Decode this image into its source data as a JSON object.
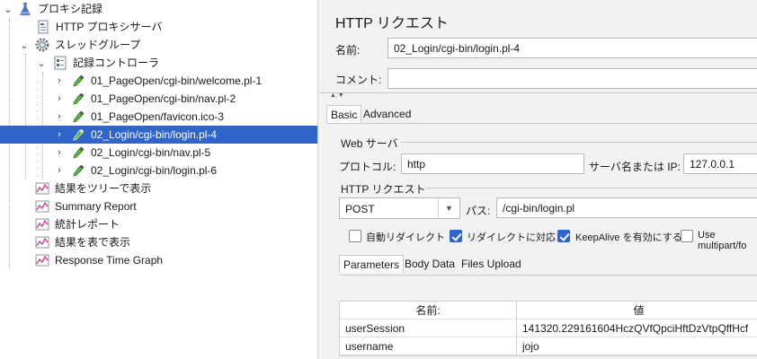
{
  "tree": {
    "items": [
      {
        "id": "proxy-root",
        "label": "プロキシ記録",
        "icon": "flask-icon",
        "toggle": "v",
        "selected": false
      },
      {
        "id": "http-proxy-server",
        "label": "HTTP プロキシサーバ",
        "icon": "config-element-icon",
        "toggle": "",
        "selected": false
      },
      {
        "id": "thread-group",
        "label": "スレッドグループ",
        "icon": "gear-icon",
        "toggle": "v",
        "selected": false
      },
      {
        "id": "recording-controller",
        "label": "記録コントローラ",
        "icon": "controller-icon",
        "toggle": "v",
        "selected": false
      },
      {
        "id": "sampler-1",
        "label": "01_PageOpen/cgi-bin/welcome.pl-1",
        "icon": "pipette-icon",
        "toggle": ">",
        "selected": false
      },
      {
        "id": "sampler-2",
        "label": "01_PageOpen/cgi-bin/nav.pl-2",
        "icon": "pipette-icon",
        "toggle": ">",
        "selected": false
      },
      {
        "id": "sampler-3",
        "label": "01_PageOpen/favicon.ico-3",
        "icon": "pipette-icon",
        "toggle": ">",
        "selected": false
      },
      {
        "id": "sampler-4",
        "label": "02_Login/cgi-bin/login.pl-4",
        "icon": "pipette-icon",
        "toggle": ">",
        "selected": true
      },
      {
        "id": "sampler-5",
        "label": "02_Login/cgi-bin/nav.pl-5",
        "icon": "pipette-icon",
        "toggle": ">",
        "selected": false
      },
      {
        "id": "sampler-6",
        "label": "02_Login/cgi-bin/login.pl-6",
        "icon": "pipette-icon",
        "toggle": ">",
        "selected": false
      },
      {
        "id": "listener-tree",
        "label": "結果をツリーで表示",
        "icon": "graph-icon",
        "toggle": "",
        "selected": false
      },
      {
        "id": "listener-summary",
        "label": "Summary Report",
        "icon": "graph-icon",
        "toggle": "",
        "selected": false
      },
      {
        "id": "listener-stats",
        "label": "統計レポート",
        "icon": "graph-icon",
        "toggle": "",
        "selected": false
      },
      {
        "id": "listener-table",
        "label": "結果を表で表示",
        "icon": "graph-icon",
        "toggle": "",
        "selected": false
      },
      {
        "id": "listener-response-time",
        "label": "Response Time Graph",
        "icon": "graph-icon",
        "toggle": "",
        "selected": false
      }
    ]
  },
  "panel": {
    "title": "HTTP リクエスト",
    "name_label": "名前:",
    "name_value": "02_Login/cgi-bin/login.pl-4",
    "comment_label": "コメント:",
    "comment_value": "",
    "tabs": {
      "basic": "Basic",
      "advanced": "Advanced"
    },
    "web_server": {
      "legend": "Web サーバ",
      "protocol_label": "プロトコル:",
      "protocol_value": "http",
      "server_label": "サーバ名または IP:",
      "server_value": "127.0.0.1"
    },
    "http_request": {
      "legend": "HTTP リクエスト",
      "method": "POST",
      "path_label": "パス:",
      "path_value": "/cgi-bin/login.pl",
      "checkboxes": [
        {
          "label": "自動リダイレクト",
          "checked": false
        },
        {
          "label": "リダイレクトに対応",
          "checked": true
        },
        {
          "label": "KeepAlive を有効にする",
          "checked": true
        },
        {
          "label": "Use multipart/fo",
          "checked": false
        }
      ]
    },
    "sub_tabs": {
      "parameters": "Parameters",
      "body_data": "Body Data",
      "files_upload": "Files Upload"
    },
    "table": {
      "headers": [
        "名前:",
        "値"
      ],
      "rows": [
        {
          "name": "userSession",
          "value": "141320.229161604HczQVfQpciHftDzVtpQffHcf"
        },
        {
          "name": "username",
          "value": "jojo"
        }
      ]
    },
    "colors": {
      "selection": "#2f65ca",
      "checkbox_checked": "#2f65ca"
    }
  }
}
